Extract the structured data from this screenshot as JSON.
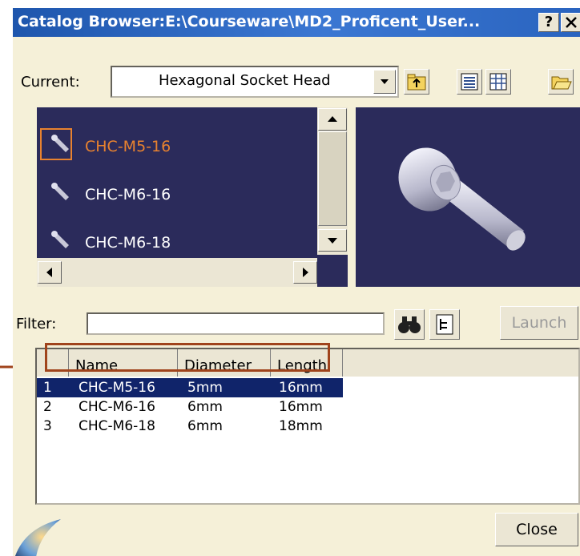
{
  "window": {
    "title": "Catalog Browser:E:\\Courseware\\MD2_Proficent_User...",
    "help_label": "?",
    "close_label": "✕"
  },
  "toolbar": {
    "current_label": "Current:",
    "current_value": "Hexagonal Socket Head"
  },
  "catalog_list": {
    "items": [
      {
        "label": "CHC-M5-16",
        "selected": true
      },
      {
        "label": "CHC-M6-16",
        "selected": false
      },
      {
        "label": "CHC-M6-18",
        "selected": false
      }
    ]
  },
  "filter": {
    "label": "Filter:",
    "value": "",
    "launch_label": "Launch"
  },
  "table": {
    "columns": [
      "Name",
      "Diameter",
      "Length"
    ],
    "rows": [
      {
        "index": "1",
        "name": "CHC-M5-16",
        "diameter": "5mm",
        "length": "16mm",
        "selected": true
      },
      {
        "index": "2",
        "name": "CHC-M6-16",
        "diameter": "6mm",
        "length": "16mm",
        "selected": false
      },
      {
        "index": "3",
        "name": "CHC-M6-18",
        "diameter": "6mm",
        "length": "18mm",
        "selected": false
      }
    ]
  },
  "footer": {
    "close_label": "Close"
  },
  "colors": {
    "title_bar": "#2a64bf",
    "list_background": "#2b2b5b",
    "selection": "#10246a",
    "selected_item_text": "#e8822f",
    "annotation": "#a0441c"
  }
}
